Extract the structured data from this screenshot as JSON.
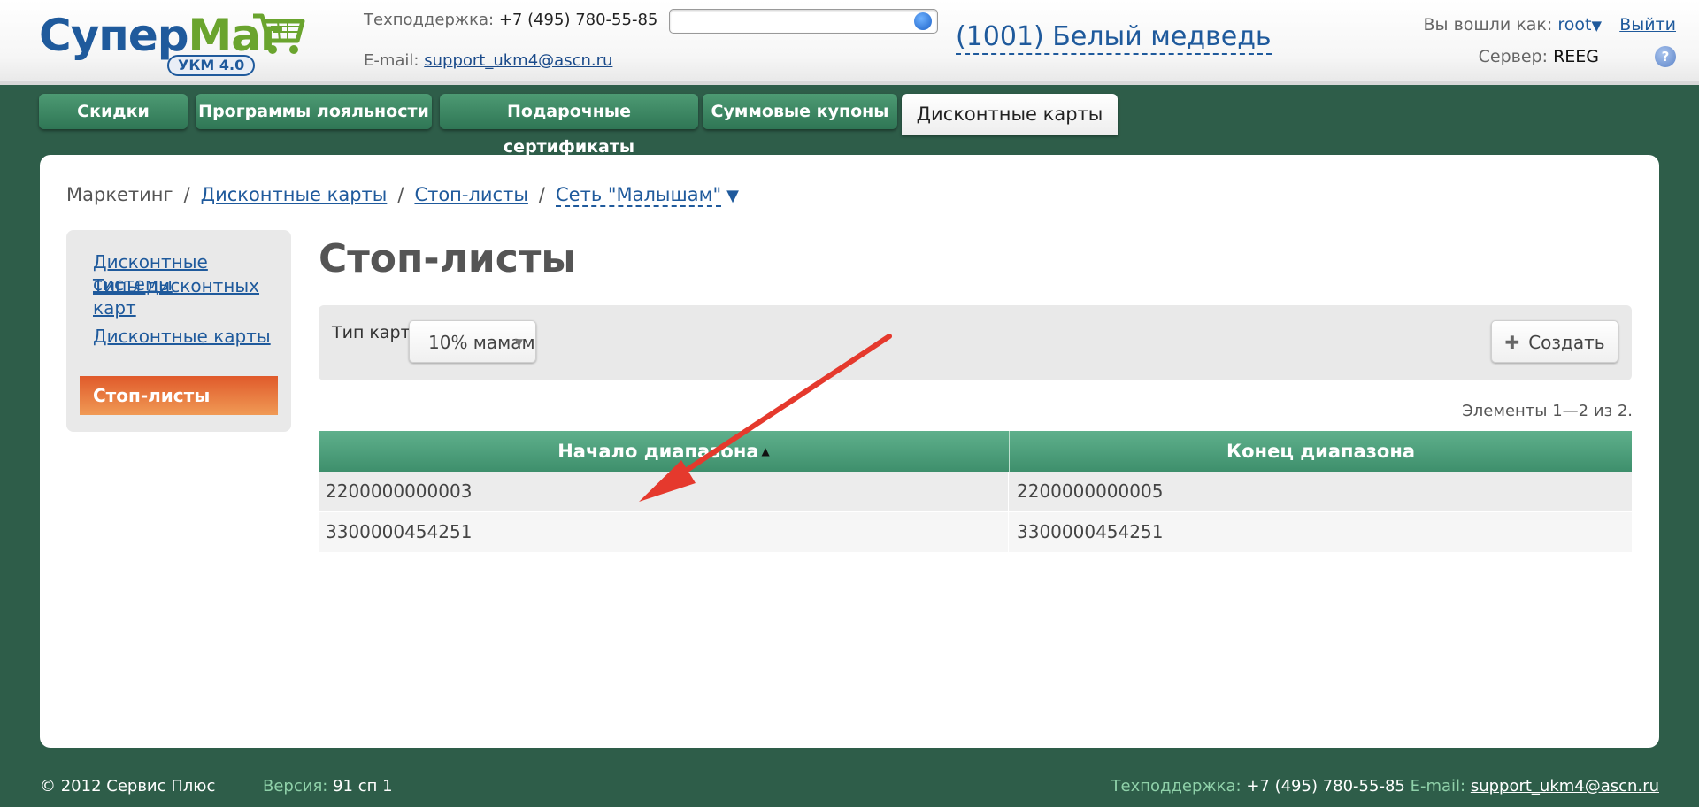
{
  "header": {
    "logo_main": "Супер",
    "logo_accent": "Маг",
    "logo_badge": "УКМ 4.0",
    "support_phone_label": "Техподдержка:",
    "support_phone": "+7 (495) 780-55-85",
    "email_label": "E-mail:",
    "email": "support_ukm4@ascn.ru",
    "search_value": "",
    "store_name": "(1001) Белый медведь",
    "logged_label": "Вы вошли как:",
    "user": "root",
    "logout": "Выйти",
    "server_label": "Сервер:",
    "server": "REEG",
    "help": "?"
  },
  "tabs": [
    {
      "label": "Скидки",
      "active": false
    },
    {
      "label": "Программы лояльности",
      "active": false
    },
    {
      "label": "Подарочные сертификаты",
      "active": false
    },
    {
      "label": "Суммовые купоны",
      "active": false
    },
    {
      "label": "Дисконтные карты",
      "active": true
    }
  ],
  "breadcrumb": {
    "root": "Маркетинг",
    "level1": "Дисконтные карты",
    "level2": "Стоп-листы",
    "level3": "Сеть \"Малышам\""
  },
  "sidebar": {
    "items": [
      {
        "label": "Дисконтные системы"
      },
      {
        "label": "Типы дисконтных карт"
      },
      {
        "label": "Дисконтные карты"
      },
      {
        "label": "Стоп-листы",
        "active": true
      }
    ]
  },
  "main": {
    "title": "Стоп-листы",
    "filter_label": "Тип карт:",
    "filter_value": "10% мамам",
    "create_label": "Создать",
    "counter": "Элементы 1—2 из 2."
  },
  "table": {
    "columns": [
      "Начало диапазона",
      "Конец диапазона"
    ],
    "sort_column": "Начало диапазона",
    "sort_direction": "asc",
    "rows": [
      [
        "2200000000003",
        "2200000000005"
      ],
      [
        "3300000454251",
        "3300000454251"
      ]
    ]
  },
  "footer": {
    "copyright": "© 2012 Сервис Плюс",
    "version_label": "Версия:",
    "version": "91 сп 1",
    "support_label": "Техподдержка:",
    "support_phone": "+7 (495) 780-55-85",
    "email_label": "E-mail:",
    "email": "support_ukm4@ascn.ru"
  },
  "colors": {
    "background": "#2e5d49",
    "tab_green": "#3e8f6c",
    "accent_orange": "#e05a2b",
    "link_blue": "#1f5a9c",
    "annotation_arrow": "#e5392d"
  }
}
